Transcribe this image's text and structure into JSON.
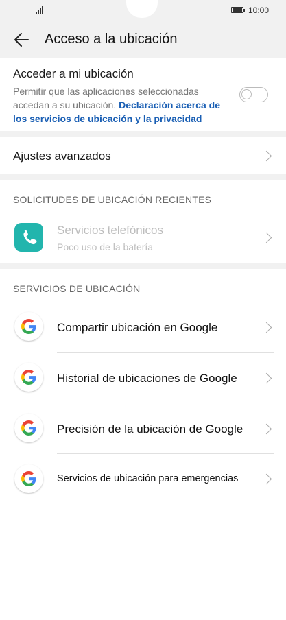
{
  "status": {
    "time": "10:00"
  },
  "header": {
    "title": "Acceso a la ubicación",
    "back_icon": "arrow-left-icon"
  },
  "location_toggle": {
    "title": "Acceder a mi ubicación",
    "description": "Permitir que las aplicaciones seleccionadas accedan a su ubicación.",
    "link": "Declaración acerca de los servicios de ubicación y la privacidad",
    "enabled": false
  },
  "advanced": {
    "label": "Ajustes avanzados"
  },
  "recent": {
    "heading": "SOLICITUDES DE UBICACIÓN RECIENTES",
    "items": [
      {
        "title": "Servicios telefónicos",
        "subtitle": "Poco uso de la batería",
        "icon": "phone-icon"
      }
    ]
  },
  "services": {
    "heading": "SERVICIOS DE UBICACIÓN",
    "items": [
      {
        "label": "Compartir ubicación en Google",
        "icon": "google-icon"
      },
      {
        "label": "Historial de ubicaciones de Google",
        "icon": "google-icon"
      },
      {
        "label": "Precisión de la ubicación de Google",
        "icon": "google-icon"
      },
      {
        "label": "Servicios de ubicación para emergencias",
        "icon": "google-icon"
      }
    ]
  },
  "colors": {
    "accent": "#1a5fb4",
    "app_icon": "#22b5ad",
    "background": "#f1f1f1"
  }
}
